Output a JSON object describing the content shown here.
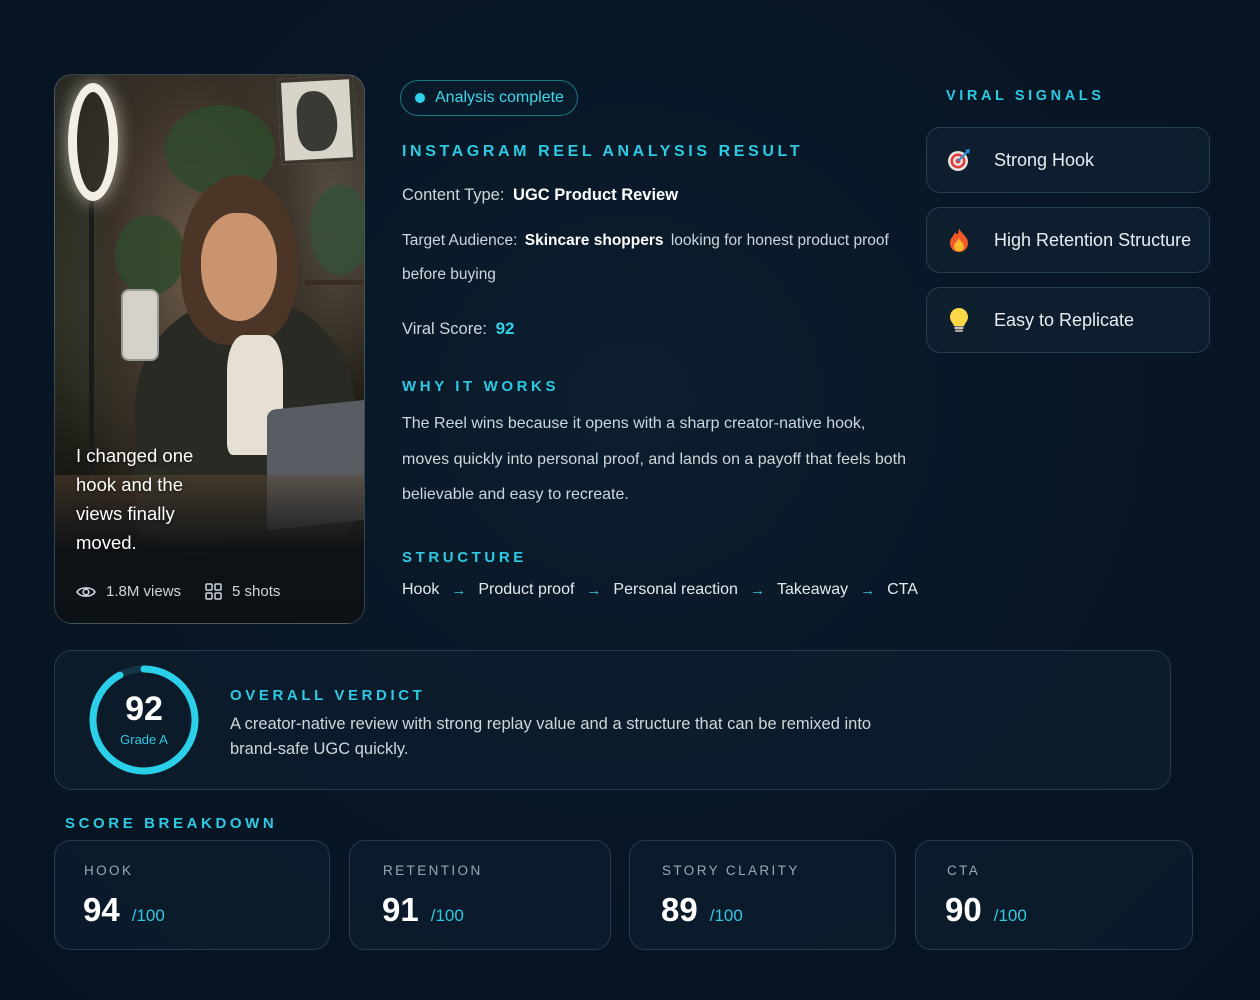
{
  "reel": {
    "caption": "I changed one hook and the views finally moved.",
    "views": "1.8M views",
    "shots": "5 shots"
  },
  "status": {
    "label": "Analysis complete"
  },
  "result": {
    "title": "INSTAGRAM REEL ANALYSIS RESULT",
    "content_type_label": "Content Type:",
    "content_type_value": "UGC Product Review",
    "audience_label": "Target Audience:",
    "audience_value": "Skincare shoppers",
    "audience_rest": "looking for honest product proof before buying",
    "viral_score_label": "Viral Score:",
    "viral_score_value": "92"
  },
  "why": {
    "title": "WHY IT WORKS",
    "text": "The Reel wins because it opens with a sharp creator-native hook, moves quickly into personal proof, and lands on a payoff that feels both believable and easy to recreate."
  },
  "structure": {
    "title": "STRUCTURE",
    "steps": [
      "Hook",
      "Product proof",
      "Personal reaction",
      "Takeaway",
      "CTA"
    ],
    "arrow": "→"
  },
  "signals": {
    "title": "VIRAL SIGNALS",
    "items": [
      {
        "label": "Strong Hook",
        "icon": "target-icon"
      },
      {
        "label": "High Retention Structure",
        "icon": "fire-icon"
      },
      {
        "label": "Easy to Replicate",
        "icon": "lightbulb-icon"
      }
    ]
  },
  "verdict": {
    "title": "OVERALL VERDICT",
    "score": "92",
    "score_fraction": 0.92,
    "grade": "Grade A",
    "text": "A creator-native review with strong replay value and a structure that can be remixed into brand-safe UGC quickly."
  },
  "breakdown": {
    "title": "SCORE BREAKDOWN",
    "max_label": "/100",
    "items": [
      {
        "label": "HOOK",
        "value": "94"
      },
      {
        "label": "RETENTION",
        "value": "91"
      },
      {
        "label": "STORY CLARITY",
        "value": "89"
      },
      {
        "label": "CTA",
        "value": "90"
      }
    ]
  },
  "colors": {
    "accent": "#2ec9e2",
    "background": "#081726",
    "card": "#0e1e2e"
  }
}
